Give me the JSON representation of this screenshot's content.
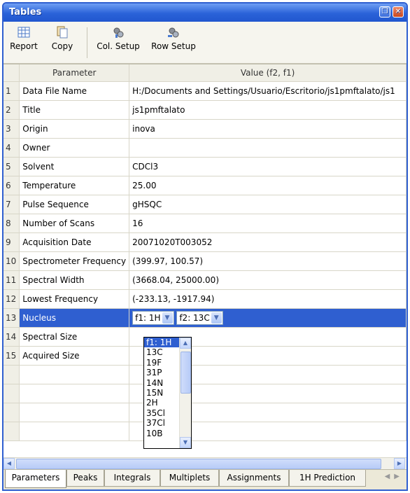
{
  "window": {
    "title": "Tables"
  },
  "toolbar": {
    "report": "Report",
    "copy": "Copy",
    "col_setup": "Col. Setup",
    "row_setup": "Row Setup"
  },
  "table": {
    "headers": {
      "num": "",
      "parameter": "Parameter",
      "value": "Value (f2, f1)"
    },
    "rows": [
      {
        "n": "1",
        "param": "Data File Name",
        "value": "H:/Documents and Settings/Usuario/Escritorio/js1pmftalato/js1"
      },
      {
        "n": "2",
        "param": "Title",
        "value": "js1pmftalato"
      },
      {
        "n": "3",
        "param": "Origin",
        "value": "inova"
      },
      {
        "n": "4",
        "param": "Owner",
        "value": ""
      },
      {
        "n": "5",
        "param": "Solvent",
        "value": "CDCl3"
      },
      {
        "n": "6",
        "param": "Temperature",
        "value": "25.00"
      },
      {
        "n": "7",
        "param": "Pulse Sequence",
        "value": "gHSQC"
      },
      {
        "n": "8",
        "param": "Number of Scans",
        "value": "16"
      },
      {
        "n": "9",
        "param": "Acquisition Date",
        "value": "20071020T003052"
      },
      {
        "n": "10",
        "param": "Spectrometer Frequency",
        "value": "(399.97, 100.57)"
      },
      {
        "n": "11",
        "param": "Spectral Width",
        "value": "(3668.04, 25000.00)"
      },
      {
        "n": "12",
        "param": "Lowest Frequency",
        "value": "(-233.13, -1917.94)"
      },
      {
        "n": "13",
        "param": "Nucleus",
        "value": ""
      },
      {
        "n": "14",
        "param": "Spectral Size",
        "value": ""
      },
      {
        "n": "15",
        "param": "Acquired Size",
        "value": ""
      }
    ],
    "nucleus": {
      "f1": "f1: 1H",
      "f2": "f2: 13C"
    }
  },
  "dropdown": {
    "options": [
      "f1: 1H",
      "13C",
      "19F",
      "31P",
      "14N",
      "15N",
      "2H",
      "35Cl",
      "37Cl",
      "10B"
    ],
    "selected": "f1: 1H"
  },
  "tabs": [
    "Parameters",
    "Peaks",
    "Integrals",
    "Multiplets",
    "Assignments",
    "1H Prediction"
  ],
  "active_tab": "Parameters",
  "colors": {
    "titlebar": "#2a62d8",
    "selection": "#2f5fd0"
  }
}
